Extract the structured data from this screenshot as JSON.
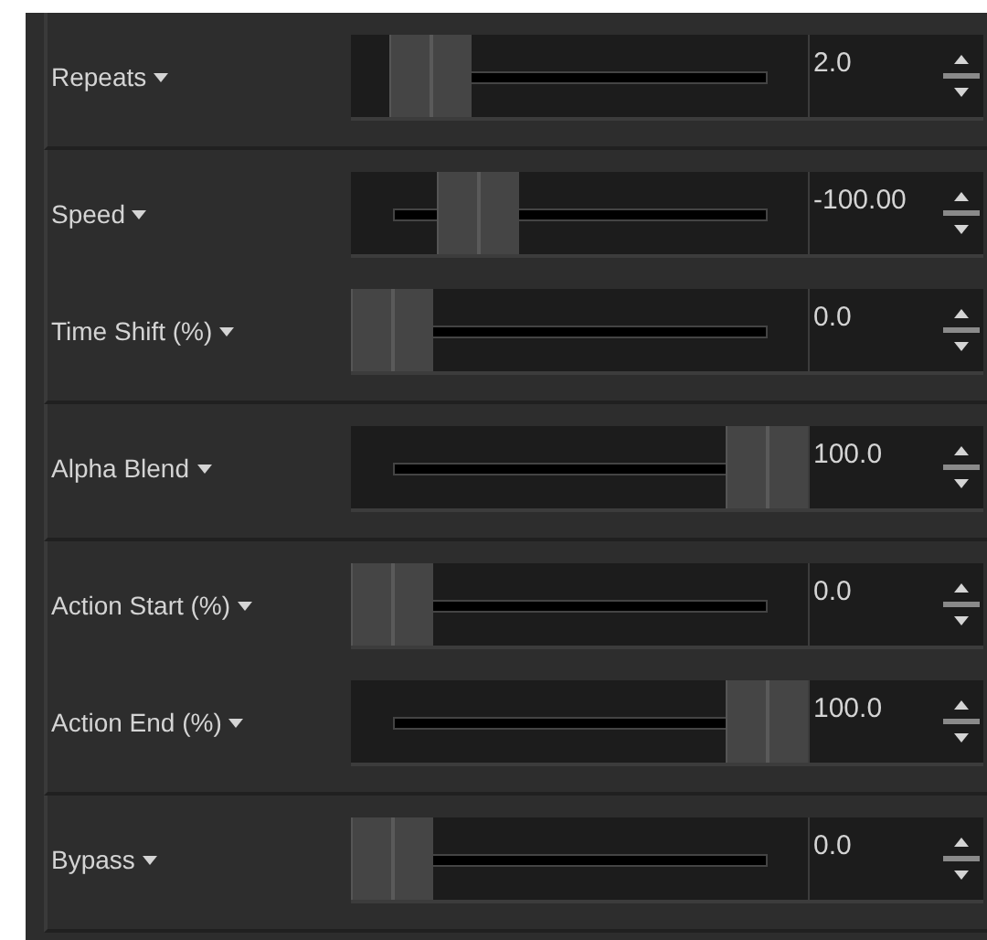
{
  "groups": [
    {
      "rows": [
        {
          "label": "Repeats",
          "level": 0.1,
          "value": "2.0"
        }
      ]
    },
    {
      "rows": [
        {
          "label": "Speed",
          "level": 0.23,
          "value": "-100.00"
        },
        {
          "label": "Time Shift (%)",
          "level": 0,
          "value": "0.0"
        }
      ]
    },
    {
      "rows": [
        {
          "label": "Alpha Blend",
          "level": 1,
          "value": "100.0"
        }
      ]
    },
    {
      "rows": [
        {
          "label": "Action Start (%)",
          "level": 0,
          "value": "0.0"
        },
        {
          "label": "Action End (%)",
          "level": 1,
          "value": "100.0"
        }
      ]
    },
    {
      "rows": [
        {
          "label": "Bypass",
          "level": 0,
          "value": "0.0"
        }
      ]
    }
  ]
}
